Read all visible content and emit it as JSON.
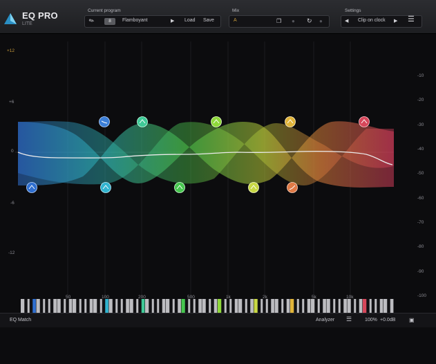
{
  "app": {
    "title": "EQ PRO",
    "subtitle": "LITE"
  },
  "preset_group": {
    "label": "Current program",
    "number": "8",
    "name": "Flamboyant",
    "load_label": "Load",
    "save_label": "Save"
  },
  "mix_group": {
    "label": "Mix",
    "value": "A"
  },
  "settings_group": {
    "label": "Settings",
    "value": "Clip on clock"
  },
  "db_scale_left": [
    "+12",
    "+6",
    "0",
    "-6",
    "-12"
  ],
  "db_scale_right": [
    "-10",
    "-20",
    "-30",
    "-40",
    "-50",
    "-60",
    "-70",
    "-80",
    "-90",
    "-100"
  ],
  "freq_labels": [
    "50",
    "100",
    "200",
    "500",
    "1k",
    "2k",
    "5k",
    "10k"
  ],
  "bottom": {
    "eq_match": "EQ Match",
    "analyzer": "Analyzer",
    "zoom": "100%",
    "gain": "+0.0dB"
  },
  "colors": {
    "accent": "#3aa7d8",
    "gold": "#c79a3b",
    "background": "#0c0c0e"
  },
  "bands": [
    {
      "name": "band-1",
      "color": "#2f6fd0",
      "icon": "high-pass-icon"
    },
    {
      "name": "band-2",
      "color": "#3c7fd8",
      "icon": "low-shelf-icon"
    },
    {
      "name": "band-3",
      "color": "#31b4cf",
      "icon": "bell-icon"
    },
    {
      "name": "band-4",
      "color": "#3fc997",
      "icon": "bell-icon"
    },
    {
      "name": "band-5",
      "color": "#47c64f",
      "icon": "bell-icon"
    },
    {
      "name": "band-6",
      "color": "#8fd83a",
      "icon": "bell-icon"
    },
    {
      "name": "band-7",
      "color": "#c8d844",
      "icon": "bell-icon"
    },
    {
      "name": "band-8",
      "color": "#e0b43a",
      "icon": "bell-icon"
    },
    {
      "name": "band-9",
      "color": "#e07a46",
      "icon": "high-shelf-icon"
    },
    {
      "name": "band-10",
      "color": "#d6475a",
      "icon": "bell-icon"
    }
  ]
}
